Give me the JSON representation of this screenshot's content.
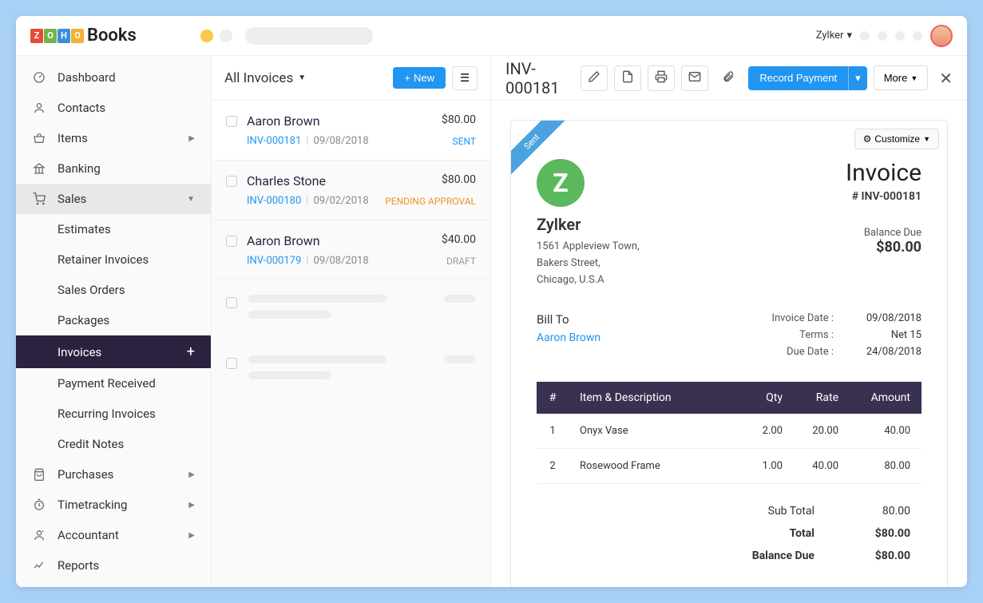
{
  "brand": {
    "name": "Books",
    "boxes": [
      "Z",
      "O",
      "H",
      "O"
    ]
  },
  "topbar": {
    "org": "Zylker"
  },
  "sidebar": {
    "items": [
      {
        "label": "Dashboard",
        "icon": "gauge"
      },
      {
        "label": "Contacts",
        "icon": "user"
      },
      {
        "label": "Items",
        "icon": "basket",
        "chev": true
      },
      {
        "label": "Banking",
        "icon": "bank"
      },
      {
        "label": "Sales",
        "icon": "cart",
        "chev": true,
        "expanded": true,
        "subs": [
          {
            "label": "Estimates"
          },
          {
            "label": "Retainer Invoices"
          },
          {
            "label": "Sales Orders"
          },
          {
            "label": "Packages"
          },
          {
            "label": "Invoices",
            "active": true,
            "plus": true
          },
          {
            "label": "Payment Received"
          },
          {
            "label": "Recurring Invoices"
          },
          {
            "label": "Credit Notes"
          }
        ]
      },
      {
        "label": "Purchases",
        "icon": "bag",
        "chev": true
      },
      {
        "label": "Timetracking",
        "icon": "clock",
        "chev": true
      },
      {
        "label": "Accountant",
        "icon": "acct",
        "chev": true
      },
      {
        "label": "Reports",
        "icon": "chart"
      }
    ]
  },
  "list": {
    "title": "All Invoices",
    "new_label": "New",
    "rows": [
      {
        "name": "Aaron Brown",
        "amount": "$80.00",
        "inv": "INV-000181",
        "date": "09/08/2018",
        "status": "SENT",
        "status_cls": "st-sent",
        "selected": true
      },
      {
        "name": "Charles Stone",
        "amount": "$80.00",
        "inv": "INV-000180",
        "date": "09/02/2018",
        "status": "PENDING APPROVAL",
        "status_cls": "st-pending"
      },
      {
        "name": "Aaron Brown",
        "amount": "$40.00",
        "inv": "INV-000179",
        "date": "09/08/2018",
        "status": "DRAFT",
        "status_cls": "st-draft"
      }
    ]
  },
  "detail": {
    "title": "INV-000181",
    "record_payment": "Record Payment",
    "more": "More",
    "customize": "Customize",
    "ribbon": "Sent",
    "company": {
      "name": "Zylker",
      "logo_letter": "Z",
      "addr1": "1561 Appleview Town,",
      "addr2": "Bakers Street,",
      "addr3": "Chicago, U.S.A"
    },
    "invoice_label": "Invoice",
    "invoice_num": "# INV-000181",
    "balance_due_label": "Balance Due",
    "balance_due": "$80.00",
    "billto_label": "Bill To",
    "billto_name": "Aaron Brown",
    "meta": [
      {
        "k": "Invoice Date :",
        "v": "09/08/2018"
      },
      {
        "k": "Terms :",
        "v": "Net 15"
      },
      {
        "k": "Due Date :",
        "v": "24/08/2018"
      }
    ],
    "headers": {
      "num": "#",
      "desc": "Item & Description",
      "qty": "Qty",
      "rate": "Rate",
      "amount": "Amount"
    },
    "items": [
      {
        "n": "1",
        "desc": "Onyx Vase",
        "qty": "2.00",
        "rate": "20.00",
        "amount": "40.00"
      },
      {
        "n": "2",
        "desc": "Rosewood Frame",
        "qty": "1.00",
        "rate": "40.00",
        "amount": "80.00"
      }
    ],
    "totals": [
      {
        "k": "Sub Total",
        "v": "80.00"
      },
      {
        "k": "Total",
        "v": "$80.00",
        "bold": true
      },
      {
        "k": "Balance Due",
        "v": "$80.00",
        "bold": true
      }
    ]
  }
}
